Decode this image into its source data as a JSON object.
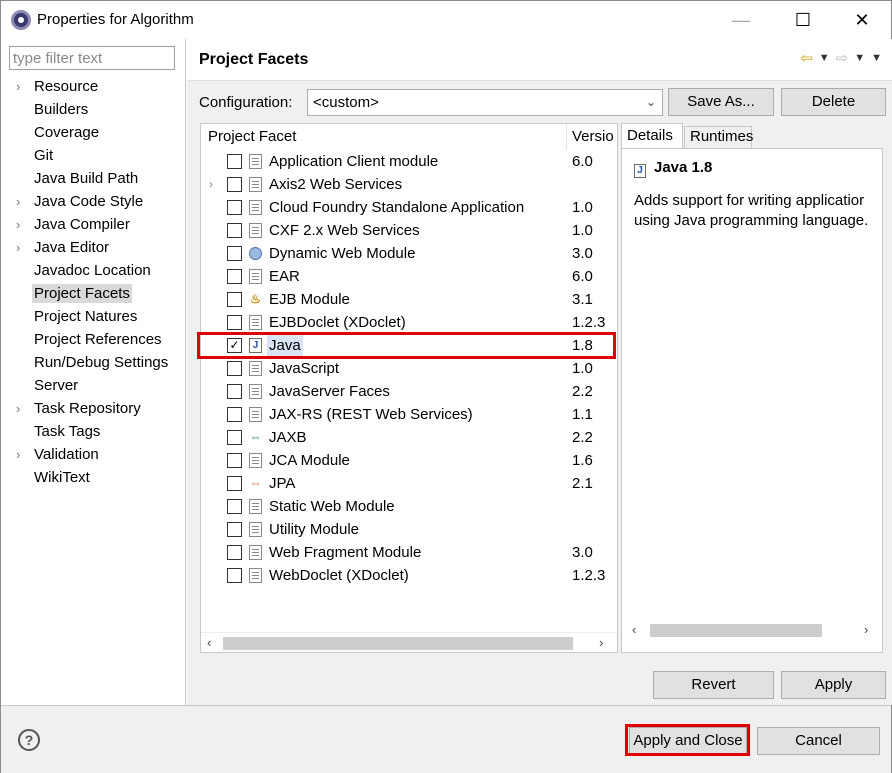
{
  "window": {
    "title": "Properties for Algorithm",
    "icon": "eclipse-icon",
    "min_glyph": "—",
    "max_glyph": "☐",
    "close_glyph": "✕"
  },
  "filter": {
    "placeholder": "type filter text",
    "value": ""
  },
  "nav": {
    "items": [
      {
        "label": "Resource",
        "expandable": true
      },
      {
        "label": "Builders",
        "expandable": false
      },
      {
        "label": "Coverage",
        "expandable": false
      },
      {
        "label": "Git",
        "expandable": false
      },
      {
        "label": "Java Build Path",
        "expandable": false
      },
      {
        "label": "Java Code Style",
        "expandable": true
      },
      {
        "label": "Java Compiler",
        "expandable": true
      },
      {
        "label": "Java Editor",
        "expandable": true
      },
      {
        "label": "Javadoc Location",
        "expandable": false
      },
      {
        "label": "Project Facets",
        "expandable": false,
        "selected": true
      },
      {
        "label": "Project Natures",
        "expandable": false
      },
      {
        "label": "Project References",
        "expandable": false
      },
      {
        "label": "Run/Debug Settings",
        "expandable": false
      },
      {
        "label": "Server",
        "expandable": false
      },
      {
        "label": "Task Repository",
        "expandable": true
      },
      {
        "label": "Task Tags",
        "expandable": false
      },
      {
        "label": "Validation",
        "expandable": true
      },
      {
        "label": "WikiText",
        "expandable": false
      }
    ]
  },
  "page": {
    "title": "Project Facets",
    "back_glyph": "⇦",
    "forward_glyph": "⇨",
    "drop_glyph": "▼"
  },
  "config": {
    "label": "Configuration:",
    "value": "<custom>",
    "save_as_label": "Save As...",
    "delete_label": "Delete"
  },
  "facets": {
    "col_facet": "Project Facet",
    "col_version": "Versio",
    "rows": [
      {
        "name": "Application Client module",
        "version": "6.0",
        "checked": false,
        "icon": "doc",
        "expandable": false
      },
      {
        "name": "Axis2 Web Services",
        "version": "",
        "checked": false,
        "icon": "doc",
        "expandable": true
      },
      {
        "name": "Cloud Foundry Standalone Application",
        "version": "1.0",
        "checked": false,
        "icon": "doc",
        "expandable": false
      },
      {
        "name": "CXF 2.x Web Services",
        "version": "1.0",
        "checked": false,
        "icon": "doc",
        "expandable": false
      },
      {
        "name": "Dynamic Web Module",
        "version": "3.0",
        "checked": false,
        "icon": "globe",
        "expandable": false
      },
      {
        "name": "EAR",
        "version": "6.0",
        "checked": false,
        "icon": "doc",
        "expandable": false
      },
      {
        "name": "EJB Module",
        "version": "3.1",
        "checked": false,
        "icon": "bean",
        "expandable": false
      },
      {
        "name": "EJBDoclet (XDoclet)",
        "version": "1.2.3",
        "checked": false,
        "icon": "doc",
        "expandable": false
      },
      {
        "name": "Java",
        "version": "1.8",
        "checked": true,
        "icon": "jfile",
        "expandable": false
      },
      {
        "name": "JavaScript",
        "version": "1.0",
        "checked": false,
        "icon": "doc",
        "expandable": false
      },
      {
        "name": "JavaServer Faces",
        "version": "2.2",
        "checked": false,
        "icon": "doc",
        "expandable": false
      },
      {
        "name": "JAX-RS (REST Web Services)",
        "version": "1.1",
        "checked": false,
        "icon": "doc",
        "expandable": false
      },
      {
        "name": "JAXB",
        "version": "2.2",
        "checked": false,
        "icon": "arrows",
        "expandable": false
      },
      {
        "name": "JCA Module",
        "version": "1.6",
        "checked": false,
        "icon": "doc",
        "expandable": false
      },
      {
        "name": "JPA",
        "version": "2.1",
        "checked": false,
        "icon": "arrows-orange",
        "expandable": false
      },
      {
        "name": "Static Web Module",
        "version": "",
        "checked": false,
        "icon": "doc",
        "expandable": false
      },
      {
        "name": "Utility Module",
        "version": "",
        "checked": false,
        "icon": "doc",
        "expandable": false
      },
      {
        "name": "Web Fragment Module",
        "version": "3.0",
        "checked": false,
        "icon": "doc",
        "expandable": false
      },
      {
        "name": "WebDoclet (XDoclet)",
        "version": "1.2.3",
        "checked": false,
        "icon": "doc",
        "expandable": false
      }
    ]
  },
  "details": {
    "tab_details": "Details",
    "tab_runtimes": "Runtimes",
    "title": "Java 1.8",
    "line1": "Adds support for writing applicatior",
    "line2": "using Java programming language."
  },
  "actions": {
    "revert_label": "Revert",
    "apply_label": "Apply",
    "apply_close_label": "Apply and Close",
    "cancel_label": "Cancel",
    "help_glyph": "?"
  },
  "colors": {
    "highlight": "#e00000",
    "selection": "#d9d9d9",
    "button_face": "#e1e1e1"
  }
}
